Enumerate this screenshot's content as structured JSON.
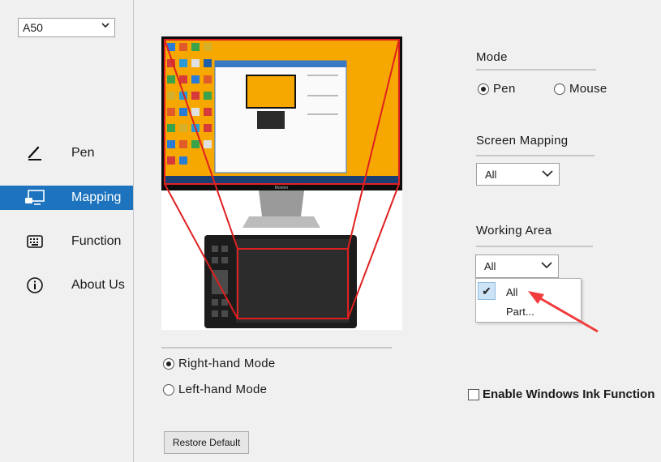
{
  "device": {
    "selected": "A50"
  },
  "sidebar": {
    "items": [
      {
        "label": "Pen",
        "icon": "pen-icon"
      },
      {
        "label": "Mapping",
        "icon": "monitor-icon"
      },
      {
        "label": "Function",
        "icon": "keyboard-icon"
      },
      {
        "label": "About Us",
        "icon": "info-icon"
      }
    ],
    "active": "Mapping"
  },
  "preview": {
    "monitor_brand": "Monitor"
  },
  "hand_mode": {
    "options": [
      "Right-hand Mode",
      "Left-hand Mode"
    ],
    "selected": "Right-hand Mode"
  },
  "mode": {
    "title": "Mode",
    "options": [
      "Pen",
      "Mouse"
    ],
    "selected": "Pen"
  },
  "screen_mapping": {
    "title": "Screen Mapping",
    "value": "All"
  },
  "working_area": {
    "title": "Working Area",
    "value": "All",
    "options": [
      "All",
      "Part..."
    ],
    "checked": "All"
  },
  "windows_ink": {
    "label": "Enable Windows Ink Function",
    "checked": false
  },
  "restore_button": "Restore Default",
  "colors": {
    "accent": "#1e73be",
    "highlight_red": "#e02020",
    "arrow_red": "#f03c3c"
  }
}
